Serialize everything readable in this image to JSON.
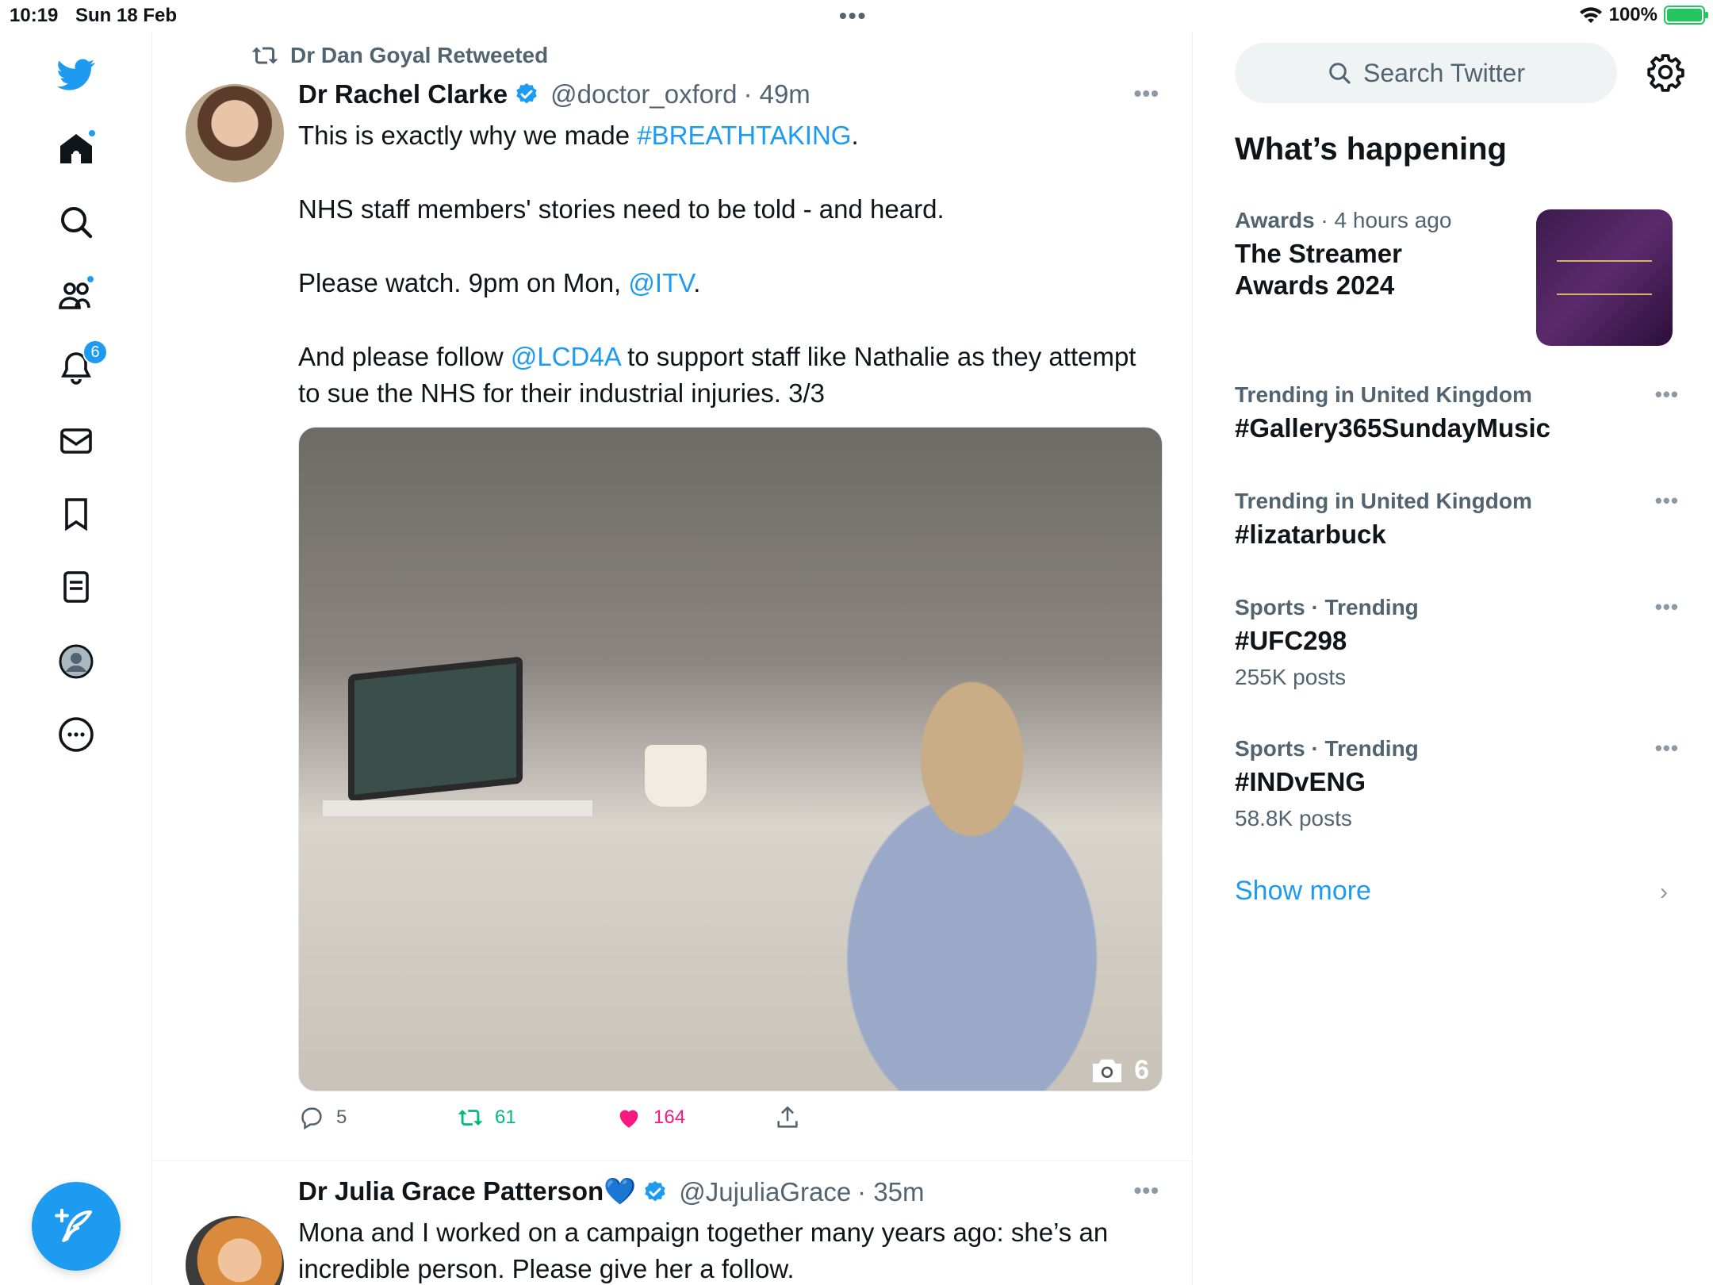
{
  "status_bar": {
    "time": "10:19",
    "date": "Sun 18 Feb",
    "battery": "100%",
    "battery_level_percent": 100,
    "multitask_dots": "•••"
  },
  "nav": {
    "notifications_badge": "6",
    "icons": [
      "twitter-bird-icon",
      "home-icon",
      "search-icon",
      "communities-icon",
      "bell-icon",
      "mail-icon",
      "bookmark-icon",
      "lists-icon",
      "profile-icon",
      "more-icon",
      "compose-icon"
    ]
  },
  "tweets": [
    {
      "retweeted_by": "Dr Dan Goyal Retweeted",
      "name": "Dr Rachel Clarke",
      "handle": "@doctor_oxford",
      "time": "· 49m",
      "more": "•••",
      "lines": {
        "l1_pre": "This is exactly why we made ",
        "l1_link": "#BREATHTAKING",
        "l1_post": ".",
        "l2": "NHS staff members' stories need to be told - and heard.",
        "l3_pre": "Please watch. 9pm on Mon, ",
        "l3_link": "@ITV",
        "l3_post": ".",
        "l4_pre": "And please follow ",
        "l4_link": "@LCD4A",
        "l4_post": " to support staff like Nathalie as they attempt to sue the NHS for their industrial injuries. 3/3"
      },
      "photo_count": "6",
      "replies": "5",
      "retweets": "61",
      "likes": "164"
    },
    {
      "name": "Dr Julia Grace Patterson💙",
      "handle": "@JujuliaGrace",
      "time": "· 35m",
      "more": "•••",
      "text": "Mona and I worked on a campaign together many years ago: she’s an incredible person. Please give her a follow."
    }
  ],
  "sidebar": {
    "search_placeholder": "Search Twitter",
    "whats_happening": "What’s happening",
    "trends": [
      {
        "category": "Awards",
        "meta": " · 4 hours ago",
        "title_l1": "The Streamer",
        "title_l2": "Awards 2024"
      },
      {
        "category": "Trending in United Kingdom",
        "title": "#Gallery365SundayMusic",
        "more": "•••"
      },
      {
        "category": "Trending in United Kingdom",
        "title": "#lizatarbuck",
        "more": "•••"
      },
      {
        "category": "Sports · Trending",
        "title": "#UFC298",
        "count": "255K posts",
        "more": "•••"
      },
      {
        "category": "Sports · Trending",
        "title": "#INDvENG",
        "count": "58.8K posts",
        "more": "•••"
      }
    ],
    "show_more": "Show more",
    "chevron": "›"
  },
  "colors": {
    "accent": "#1d9bf0",
    "retweet_green": "#00ba7c",
    "like_pink": "#f91880",
    "muted": "#536471"
  }
}
